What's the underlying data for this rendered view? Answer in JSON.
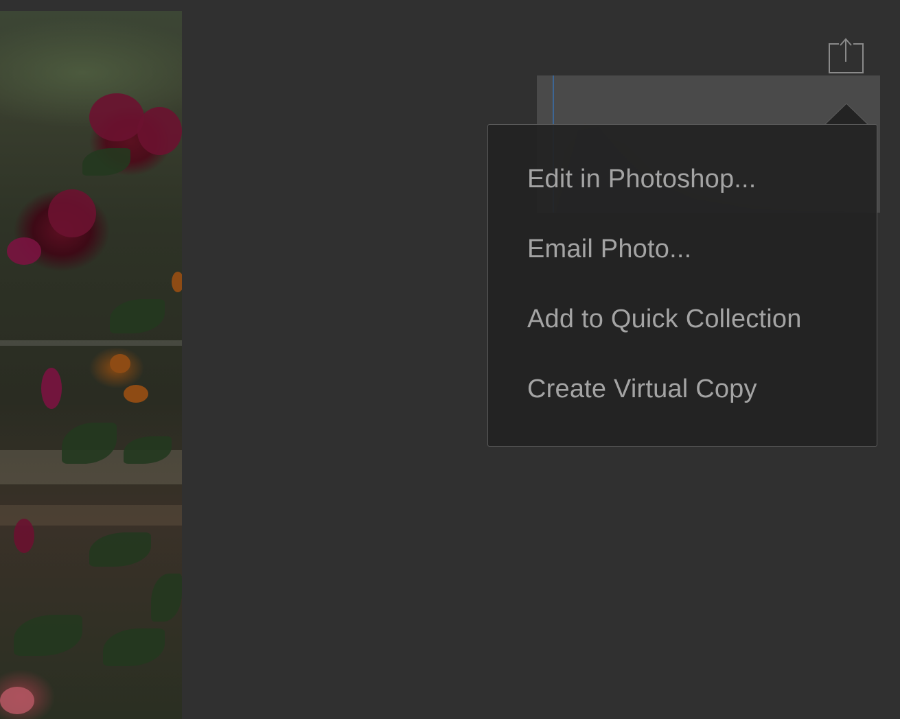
{
  "toolbar": {
    "share_icon": "share-icon"
  },
  "share_menu": {
    "items": [
      {
        "label": "Edit in Photoshop..."
      },
      {
        "label": "Email Photo..."
      },
      {
        "label": "Add to Quick Collection"
      },
      {
        "label": "Create Virtual Copy"
      }
    ]
  },
  "colors": {
    "background": "#303030",
    "menu_background": "#222222",
    "menu_text": "#a4a4a4",
    "histogram_panel": "#4a4a4a"
  }
}
